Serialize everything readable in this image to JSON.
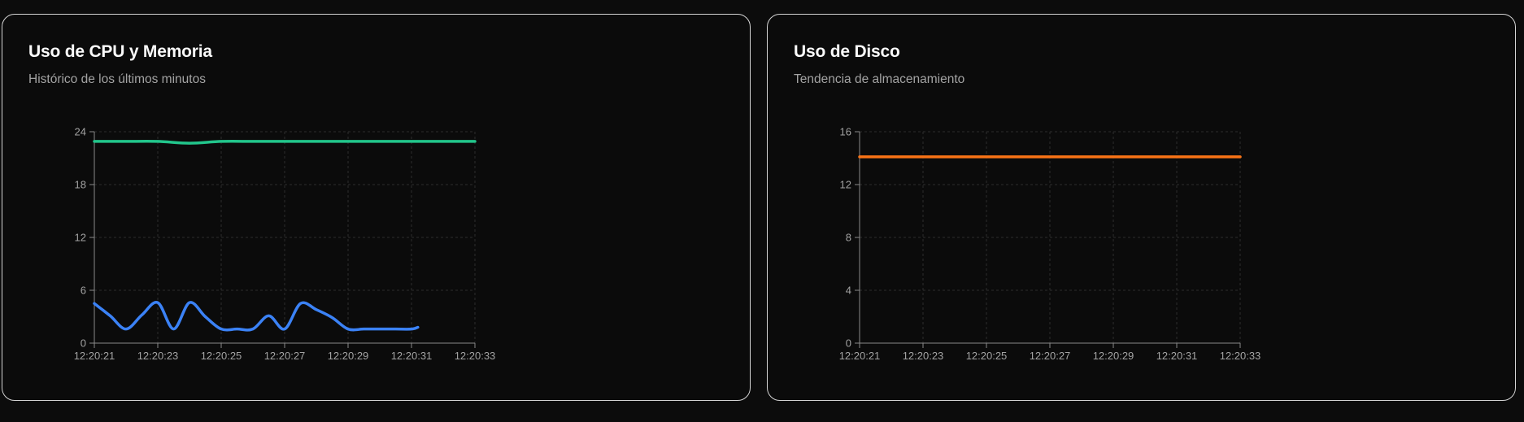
{
  "colors": {
    "background": "#0c0c0c",
    "card_border": "#d4d4d4",
    "grid": "#2e2e2e",
    "axis": "#8a8a8a"
  },
  "cards": [
    {
      "title": "Uso de CPU y Memoria",
      "subtitle": "Histórico de los últimos minutos"
    },
    {
      "title": "Uso de Disco",
      "subtitle": "Tendencia de almacenamiento"
    }
  ],
  "chart_data": [
    {
      "type": "line",
      "title": "Uso de CPU y Memoria",
      "xlabel": "",
      "ylabel": "",
      "ylim": [
        0,
        24
      ],
      "yticks": [
        0,
        6,
        12,
        18,
        24
      ],
      "xticks": [
        "12:20:21",
        "12:20:23",
        "12:20:25",
        "12:20:27",
        "12:20:29",
        "12:20:31",
        "12:20:33"
      ],
      "xlim": [
        "12:20:21",
        "12:20:33"
      ],
      "grid": true,
      "series": [
        {
          "color": "#22c58b",
          "x": [
            "12:20:21",
            "12:20:22",
            "12:20:23",
            "12:20:24",
            "12:20:25",
            "12:20:26",
            "12:20:27",
            "12:20:28",
            "12:20:29",
            "12:20:30",
            "12:20:31",
            "12:20:32",
            "12:20:33"
          ],
          "values": [
            22.9,
            22.9,
            22.9,
            22.7,
            22.9,
            22.9,
            22.9,
            22.9,
            22.9,
            22.9,
            22.9,
            22.9,
            22.9
          ]
        },
        {
          "color": "#3b82f6",
          "x": [
            "12:20:21",
            "12:20:21.5",
            "12:20:22",
            "12:20:22.5",
            "12:20:23",
            "12:20:23.5",
            "12:20:24",
            "12:20:24.5",
            "12:20:25",
            "12:20:25.5",
            "12:20:26",
            "12:20:26.5",
            "12:20:27",
            "12:20:27.5",
            "12:20:28",
            "12:20:28.5",
            "12:20:29",
            "12:20:29.5",
            "12:20:30",
            "12:20:30.5",
            "12:20:31",
            "12:20:31.2"
          ],
          "values": [
            4.5,
            3.1,
            1.6,
            3.2,
            4.6,
            1.6,
            4.6,
            3.0,
            1.6,
            1.6,
            1.6,
            3.1,
            1.6,
            4.5,
            3.8,
            2.9,
            1.6,
            1.6,
            1.6,
            1.6,
            1.6,
            1.8
          ]
        }
      ]
    },
    {
      "type": "line",
      "title": "Uso de Disco",
      "xlabel": "",
      "ylabel": "",
      "ylim": [
        0,
        16
      ],
      "yticks": [
        0,
        4,
        8,
        12,
        16
      ],
      "xticks": [
        "12:20:21",
        "12:20:23",
        "12:20:25",
        "12:20:27",
        "12:20:29",
        "12:20:31",
        "12:20:33"
      ],
      "xlim": [
        "12:20:21",
        "12:20:33"
      ],
      "grid": true,
      "series": [
        {
          "color": "#f97316",
          "x": [
            "12:20:21",
            "12:20:23",
            "12:20:25",
            "12:20:27",
            "12:20:29",
            "12:20:31",
            "12:20:33"
          ],
          "values": [
            14.1,
            14.1,
            14.1,
            14.1,
            14.1,
            14.1,
            14.1
          ]
        }
      ]
    }
  ]
}
